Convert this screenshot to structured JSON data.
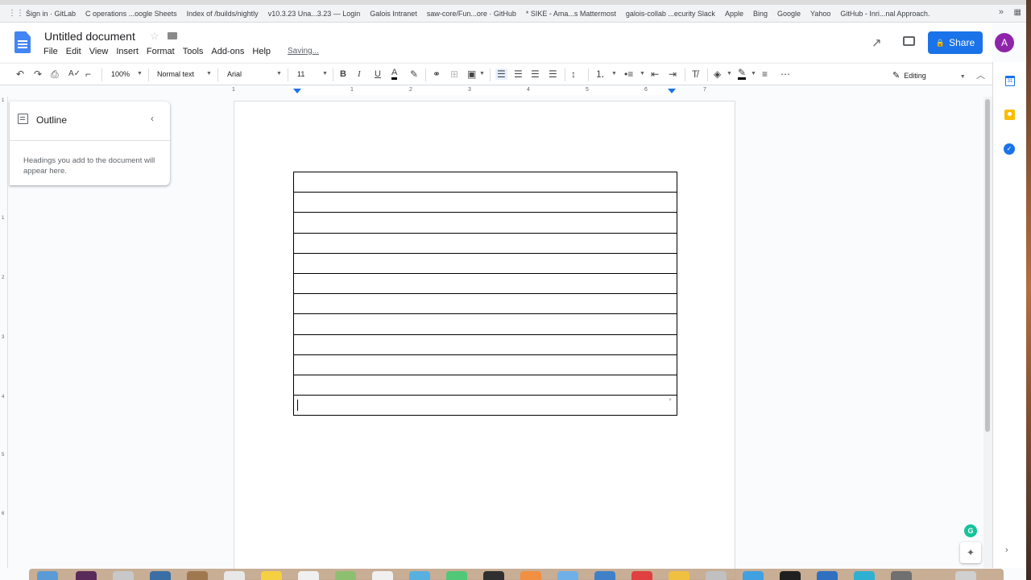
{
  "bookmarks": [
    "Sign in · GitLab",
    "C operations ...oogle Sheets",
    "Index of /builds/nightly",
    "v10.3.23 Una...3.23 — Login",
    "Galois Intranet",
    "saw-core/Fun...ore · GitHub",
    "* SIKE - Ama...s Mattermost",
    "galois-collab ...ecurity Slack",
    "Apple",
    "Bing",
    "Google",
    "Yahoo",
    "GitHub - Inri...nal Approach."
  ],
  "bookmarks_more": "»",
  "doc": {
    "title": "Untitled document",
    "menus": [
      "File",
      "Edit",
      "View",
      "Insert",
      "Format",
      "Tools",
      "Add-ons",
      "Help"
    ],
    "status": "Saving...",
    "share_label": "Share",
    "avatar_initial": "A"
  },
  "toolbar": {
    "zoom": "100%",
    "style": "Normal text",
    "font": "Arial",
    "font_size": "11",
    "bold": "B",
    "italic": "I",
    "underline": "U",
    "text_color": "A",
    "mode": "Editing"
  },
  "ruler": [
    "1",
    "1",
    "2",
    "3",
    "4",
    "5",
    "6",
    "7"
  ],
  "vruler": [
    "1",
    "1",
    "2",
    "3",
    "4",
    "5",
    "6"
  ],
  "outline": {
    "title": "Outline",
    "hint": "Headings you add to the document will appear here."
  },
  "table": {
    "rows": 12,
    "columns": 1
  },
  "side_panel": {
    "calendar_day": "31"
  },
  "colors": {
    "accent": "#1a73e8",
    "avatar": "#8e24aa",
    "grammarly": "#15c39a",
    "keep": "#fbbc04"
  },
  "icons": [
    "undo-icon",
    "redo-icon",
    "print-icon",
    "spellcheck-icon",
    "paint-format-icon",
    "highlight-icon",
    "link-icon",
    "comment-add-icon",
    "image-icon",
    "align-left-icon",
    "align-center-icon",
    "align-right-icon",
    "justify-icon",
    "line-spacing-icon",
    "numbered-list-icon",
    "bulleted-list-icon",
    "decrease-indent-icon",
    "increase-indent-icon",
    "clear-formatting-icon",
    "border-color-icon",
    "pencil-icon"
  ]
}
